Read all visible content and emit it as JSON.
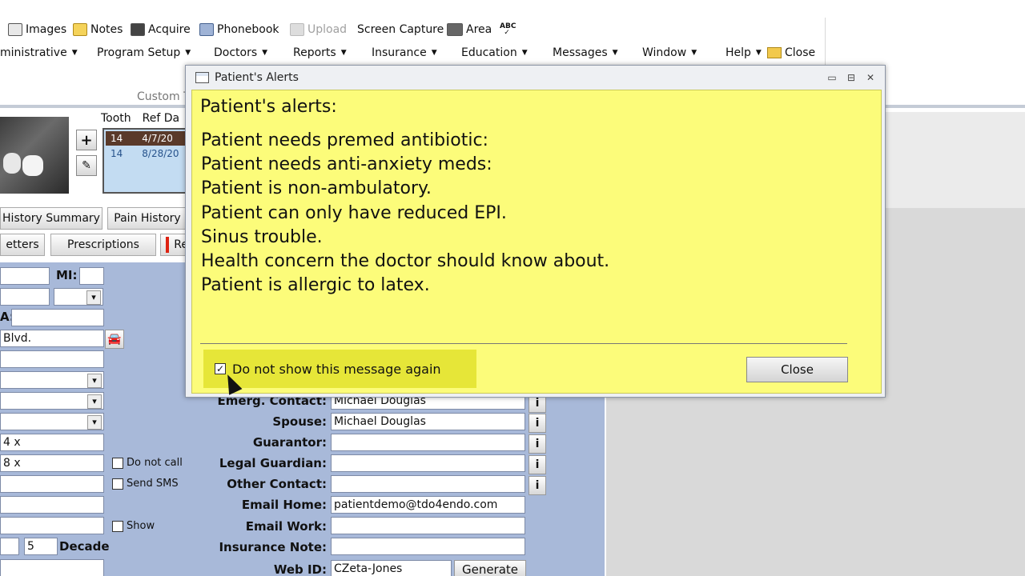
{
  "toolbar": {
    "row1": [
      {
        "label": "Images",
        "icon": "images-icon",
        "enabled": true
      },
      {
        "label": "Notes",
        "icon": "notes-icon",
        "enabled": true
      },
      {
        "label": "Acquire",
        "icon": "camera-icon",
        "enabled": true
      },
      {
        "label": "Phonebook",
        "icon": "phonebook-icon",
        "enabled": true
      },
      {
        "label": "Upload",
        "icon": "upload-icon",
        "enabled": false
      },
      {
        "label": "Screen Capture",
        "icon": "",
        "enabled": true
      },
      {
        "label": "Area",
        "icon": "area-capture-icon",
        "enabled": true
      },
      {
        "label": "",
        "icon": "spellcheck-icon",
        "enabled": true
      }
    ],
    "menus": [
      {
        "label": "ministrative"
      },
      {
        "label": "Program Setup"
      },
      {
        "label": "Doctors"
      },
      {
        "label": "Reports"
      },
      {
        "label": "Insurance"
      },
      {
        "label": "Education"
      },
      {
        "label": "Messages"
      },
      {
        "label": "Window"
      },
      {
        "label": "Help"
      }
    ],
    "close_label": "Close",
    "custom_label": "Custom T"
  },
  "grid": {
    "headers": [
      "Tooth",
      "Ref Da"
    ],
    "rows": [
      {
        "tooth": "14",
        "date": "4/7/20",
        "selected": true
      },
      {
        "tooth": "14",
        "date": "8/28/20",
        "selected": false
      }
    ]
  },
  "tabs": {
    "history_summary": "History Summary",
    "pain_history": "Pain History",
    "letters": "etters",
    "prescriptions": "Prescriptions",
    "re": "Re"
  },
  "form": {
    "mi_label": "MI:",
    "a_label": "A:",
    "address_value": "Blvd.",
    "phone1": "4 x",
    "phone2": "8 x",
    "do_not_call": "Do not call",
    "send_sms": "Send SMS",
    "show": "Show",
    "decade_value": "5",
    "decade_label": "Decade",
    "emerg_contact_label": "Emerg. Contact:",
    "emerg_contact_value": "Michael Douglas",
    "spouse_label": "Spouse:",
    "spouse_value": "Michael Douglas",
    "guarantor_label": "Guarantor:",
    "legal_guardian_label": "Legal Guardian:",
    "other_contact_label": "Other Contact:",
    "email_home_label": "Email Home:",
    "email_home_value": "patientdemo@tdo4endo.com",
    "email_work_label": "Email Work:",
    "insurance_note_label": "Insurance Note:",
    "web_id_label": "Web ID:",
    "web_id_value": "CZeta-Jones",
    "generate_label": "Generate",
    "info_glyph": "i"
  },
  "dialog": {
    "title": "Patient's Alerts",
    "header": "Patient's alerts:",
    "alerts": [
      "Patient needs premed antibiotic:",
      "Patient needs anti-anxiety meds:",
      "Patient is non-ambulatory.",
      "Patient can only have reduced EPI.",
      "Sinus trouble.",
      "Health concern the doctor should know about.",
      "Patient is allergic to latex."
    ],
    "dont_show_label": "Do not show this message again",
    "dont_show_checked": true,
    "close_label": "Close",
    "body_color": "#fcfc7a",
    "highlight_color": "#e6e638"
  }
}
